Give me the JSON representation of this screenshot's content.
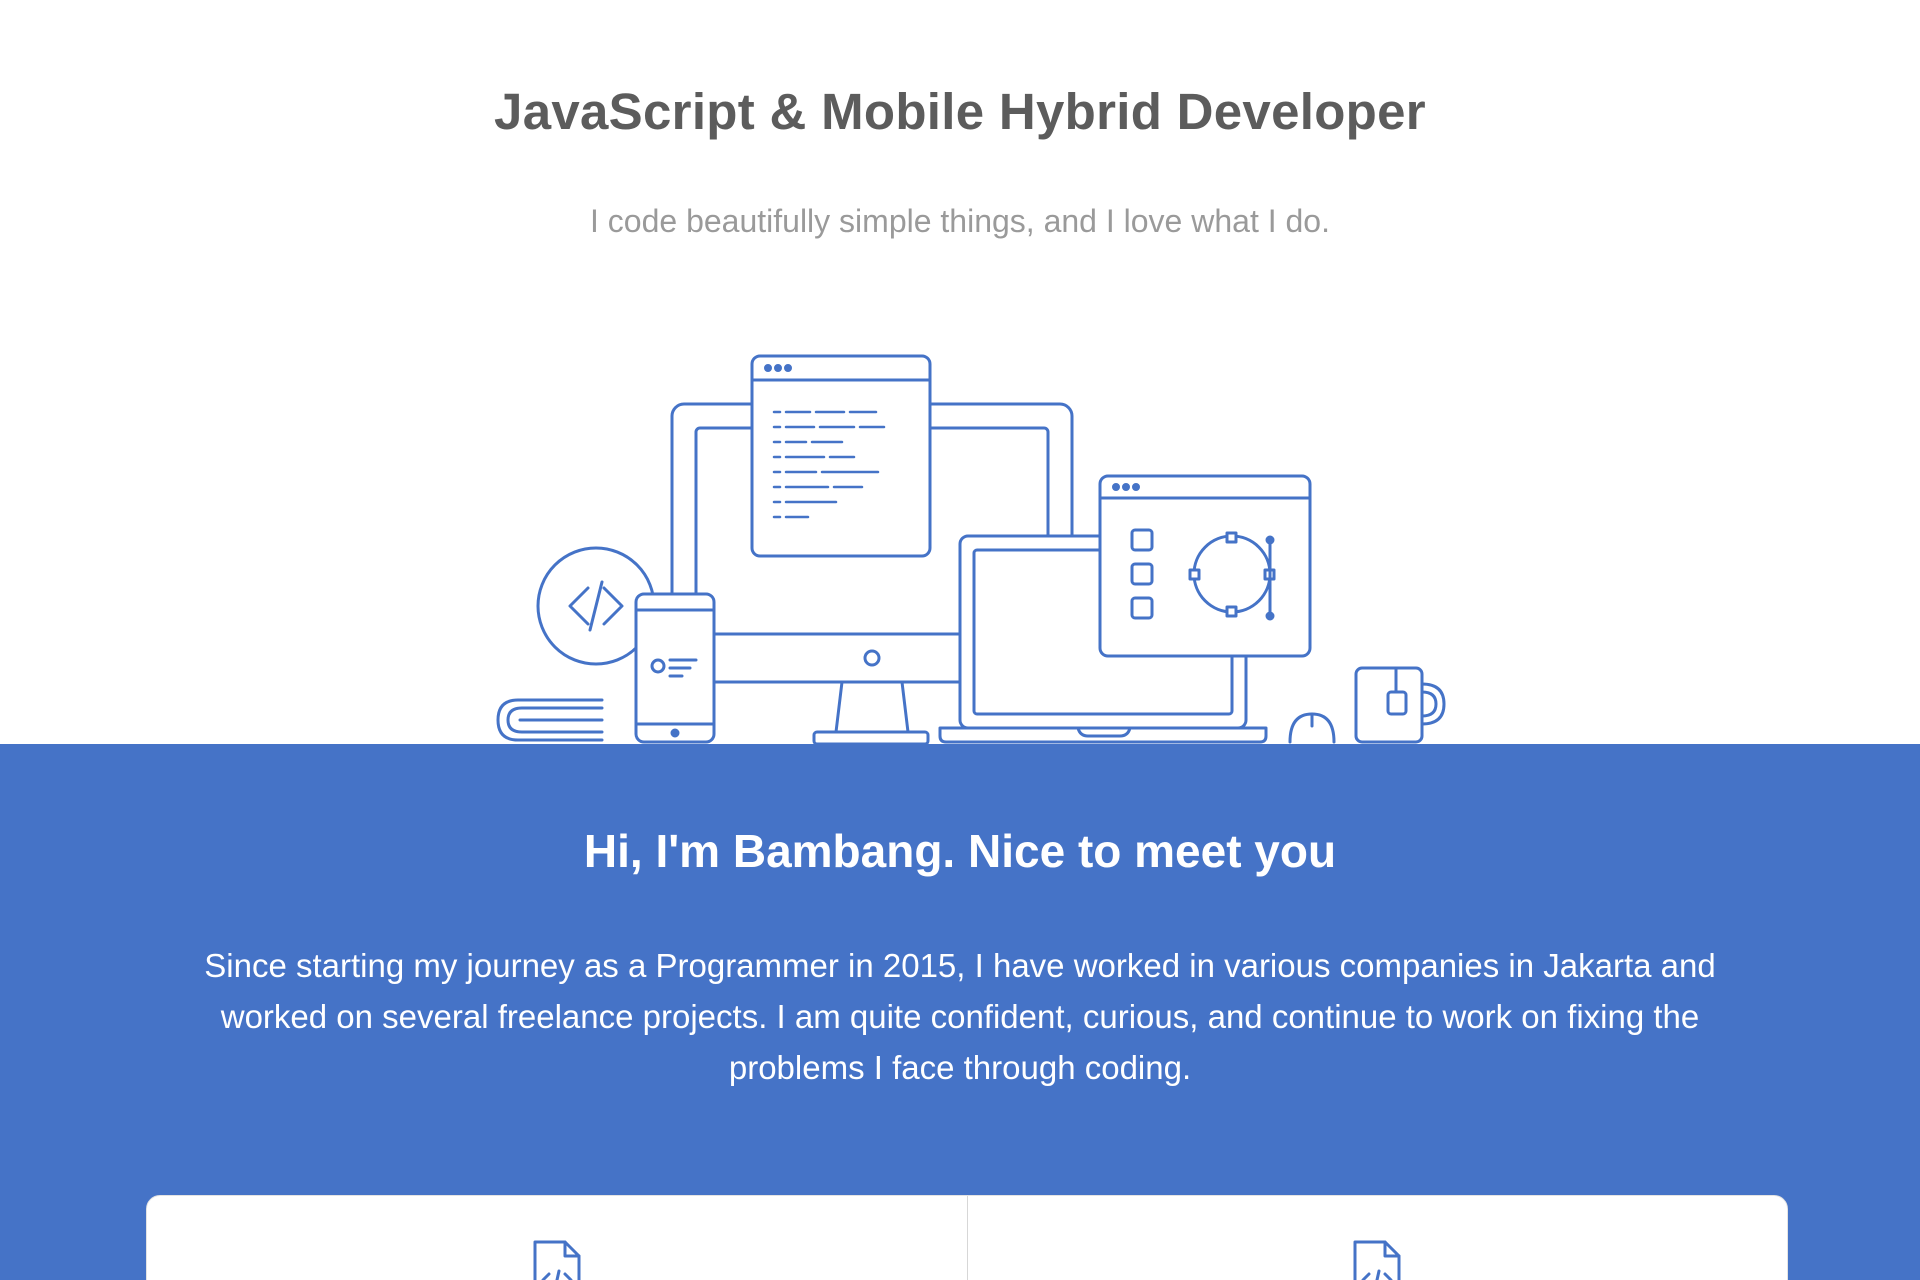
{
  "hero": {
    "title": "JavaScript & Mobile Hybrid Developer",
    "subtitle": "I code beautifully simple things, and I love what I do.",
    "illustration": "workspace-devices-illustration"
  },
  "about": {
    "title": "Hi, I'm Bambang. Nice to meet you",
    "text": "Since starting my journey as a Programmer in 2015, I have worked in various companies in Jakarta and worked on several freelance projects. I am quite confident, curious, and continue to work on fixing the problems I face through coding."
  },
  "cards": [
    {
      "icon": "code-file-icon"
    },
    {
      "icon": "code-file-icon"
    }
  ],
  "colors": {
    "accent": "#4573c7",
    "title_text": "#5c5c5c",
    "subtitle_text": "#9a9a9a",
    "background": "#ffffff"
  }
}
